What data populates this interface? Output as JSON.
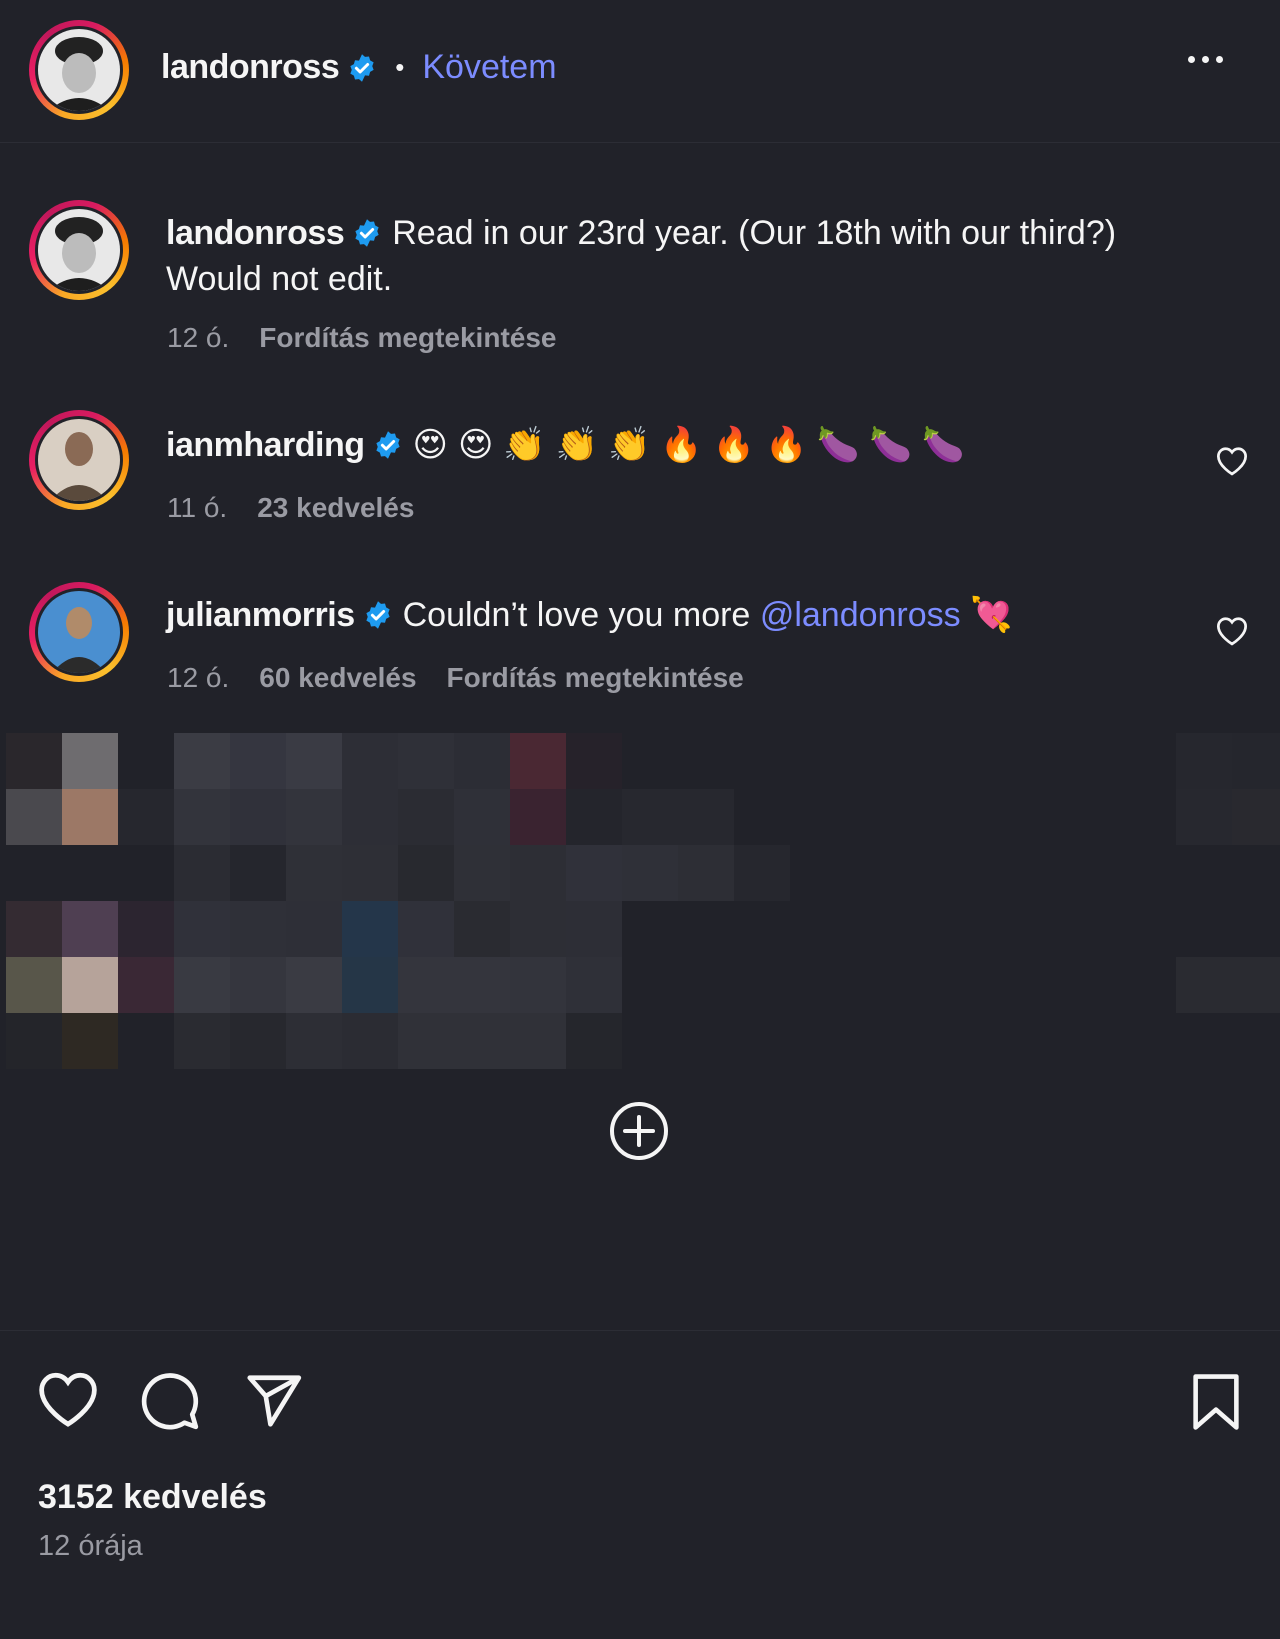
{
  "post": {
    "author": "landonross",
    "follow_label": "Követem",
    "separator": "•"
  },
  "comments": [
    {
      "username": "landonross",
      "text": "Read in our 23rd year. (Our 18th with our third?) Would not edit.",
      "time": "12 ó.",
      "translate": "Fordítás megtekintése"
    },
    {
      "username": "ianmharding",
      "text": "😍😍👏👏👏🔥🔥🔥🍆🍆🍆",
      "time": "11 ó.",
      "likes": "23 kedvelés"
    },
    {
      "username": "julianmorris",
      "text": "Couldn’t love you more",
      "mention": "@landonross",
      "emoji": "💘",
      "time": "12 ó.",
      "likes": "60 kedvelés",
      "translate": "Fordítás megtekintése"
    }
  ],
  "footer": {
    "likes": "3152 kedvelés",
    "posted": "12 órája"
  },
  "colors": {
    "background": "#212229",
    "accent": "#7c8cff",
    "verified": "#1e9bf0",
    "muted": "#9a9ba3"
  },
  "icons": [
    "verified-icon",
    "more-icon",
    "heart-icon",
    "comment-icon",
    "share-icon",
    "bookmark-icon",
    "add-circle-icon"
  ]
}
